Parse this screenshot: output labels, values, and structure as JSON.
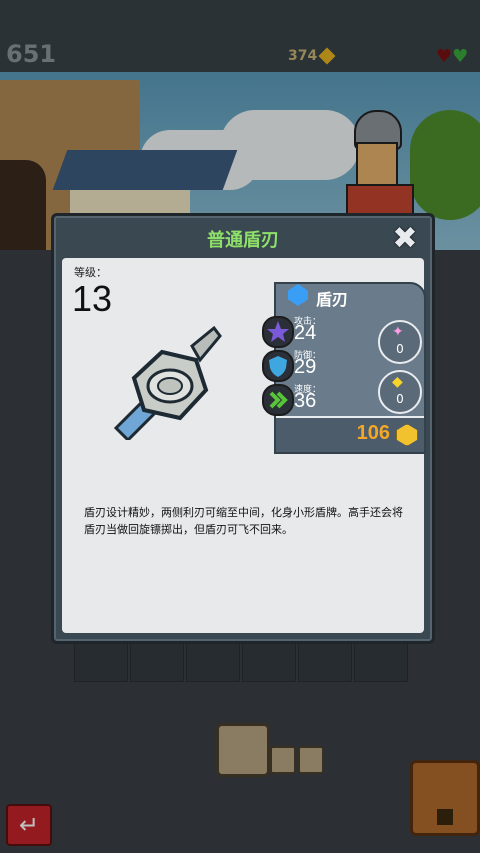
{
  "hud": {
    "score": "651",
    "coins": "374",
    "hearts_icon": "broken-heart-and-heart-icon"
  },
  "dialog": {
    "title": "普通盾刃",
    "close_symbol": "✖",
    "level_label": "等级：",
    "level_value": "13",
    "item_icon": "shield-blade-icon",
    "stats": {
      "name": "盾刃",
      "attack_label": "攻击：",
      "attack_value": "24",
      "defense_label": "防御：",
      "defense_value": "29",
      "speed_label": "速度：",
      "speed_value": "36",
      "pink_gem_count": "0",
      "yellow_gem_count": "0",
      "price": "106"
    },
    "description": "盾刃设计精妙，两侧利刃可缩至中间，化身小形盾牌。高手还会将盾刃当做回旋镖掷出，但盾刃可飞不回来。"
  },
  "colors": {
    "title_green": "#8ee068",
    "price_orange": "#f4a727",
    "panel_bg": "#e8e9ea"
  },
  "bottom": {
    "back_symbol": "↵"
  }
}
